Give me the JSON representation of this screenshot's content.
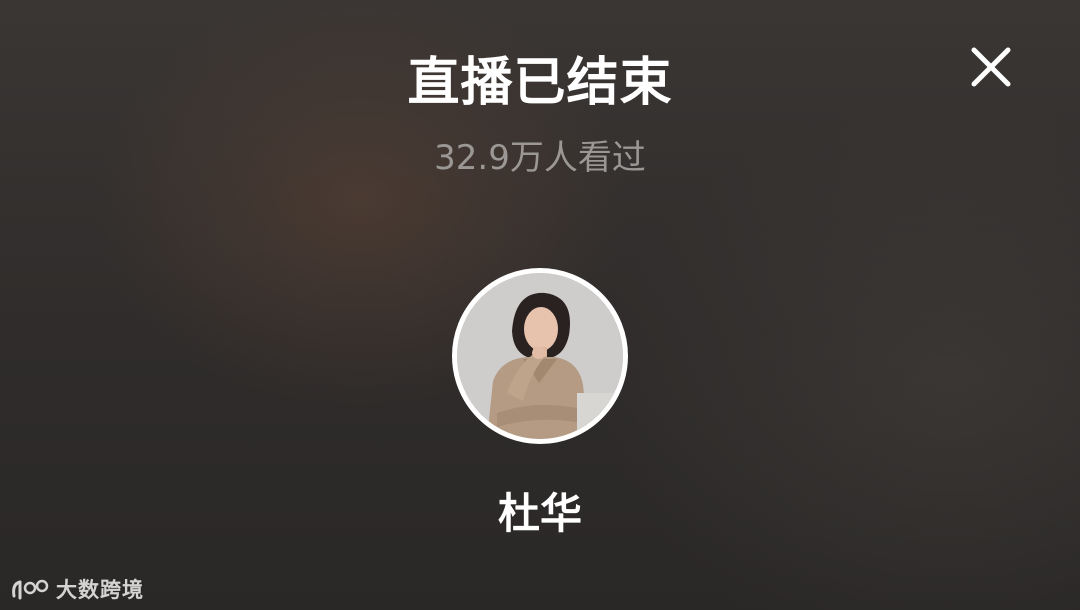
{
  "header": {
    "title": "直播已结束",
    "viewers": "32.9万人看过",
    "close_icon": "close-icon"
  },
  "host": {
    "name": "杜华",
    "avatar_icon": "avatar"
  },
  "watermark": {
    "logo_text": "100",
    "text": "大数跨境"
  },
  "colors": {
    "title": "#ffffff",
    "viewers": "#9a9794",
    "background": "#2f2c2b"
  }
}
